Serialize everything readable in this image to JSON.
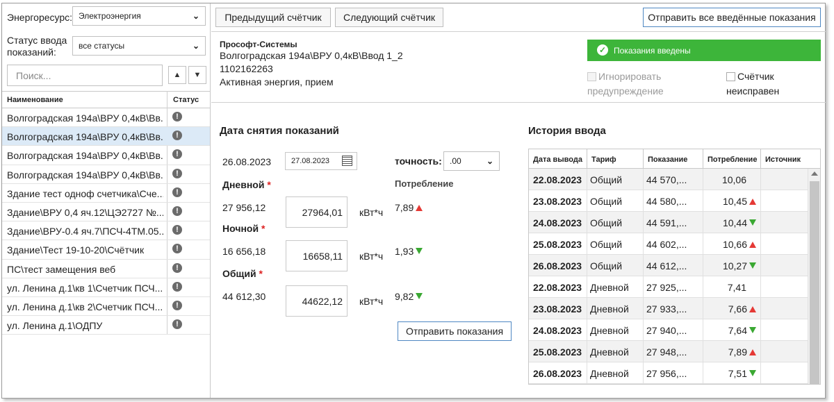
{
  "sidebar": {
    "resource_label": "Энергоресурс:",
    "resource_value": "Электроэнергия",
    "status_label_1": "Статус ввода",
    "status_label_2": "показаний:",
    "status_value": "все статусы",
    "search_placeholder": "Поиск...",
    "col_name": "Наименование",
    "col_status": "Статус",
    "items": [
      {
        "label": "Волгоградская 194а\\ВРУ 0,4кВ\\Вв...",
        "selected": false
      },
      {
        "label": "Волгоградская 194а\\ВРУ 0,4кВ\\Вв...",
        "selected": true
      },
      {
        "label": "Волгоградская 194а\\ВРУ 0,4кВ\\Вв...",
        "selected": false
      },
      {
        "label": "Волгоградская 194а\\ВРУ 0,4кВ\\Вв...",
        "selected": false
      },
      {
        "label": "Здание тест одноф счетчика\\Сче...",
        "selected": false
      },
      {
        "label": "Здание\\ВРУ 0,4 яч.12\\ЦЭ2727 №...",
        "selected": false
      },
      {
        "label": "Здание\\ВРУ-0.4 яч.7\\ПСЧ-4ТМ.05...",
        "selected": false
      },
      {
        "label": "Здание\\Тест 19-10-20\\Счётчик",
        "selected": false
      },
      {
        "label": "ПС\\тест замещения веб",
        "selected": false
      },
      {
        "label": "ул. Ленина д.1\\кв 1\\Счетчик ПСЧ...",
        "selected": false
      },
      {
        "label": "ул. Ленина д.1\\кв 2\\Счетчик ПСЧ...",
        "selected": false
      },
      {
        "label": "ул. Ленина д.1\\ОДПУ",
        "selected": false
      }
    ]
  },
  "toolbar": {
    "prev": "Предыдущий счётчик",
    "next": "Следующий счётчик",
    "send_all": "Отправить все введённые показания"
  },
  "meter": {
    "org": "Прософт-Системы",
    "path": "Волгоградская 194а\\ВРУ 0,4кВ\\Ввод 1_2",
    "serial": "1102162263",
    "type": "Активная энергия, прием",
    "badge": "Показания введены",
    "ignore_1": "Игнорировать",
    "ignore_2": "предупреждение",
    "faulty_1": "Счётчик",
    "faulty_2": "неисправен"
  },
  "readings": {
    "title": "Дата снятия показаний",
    "prev_date": "26.08.2023",
    "date_value": "27.08.2023",
    "accuracy_label": "точность:",
    "accuracy_value": ".00",
    "consumption_header": "Потребление",
    "tariffs": [
      {
        "name": "Дневной",
        "prev": "27 956,12",
        "value": "27964,01",
        "unit": "кВт*ч",
        "consumption": "7,89",
        "trend": "up"
      },
      {
        "name": "Ночной",
        "prev": "16 656,18",
        "value": "16658,11",
        "unit": "кВт*ч",
        "consumption": "1,93",
        "trend": "down"
      },
      {
        "name": "Общий",
        "prev": "44 612,30",
        "value": "44622,12",
        "unit": "кВт*ч",
        "consumption": "9,82",
        "trend": "down"
      }
    ],
    "submit": "Отправить показания"
  },
  "history": {
    "title": "История ввода",
    "columns": [
      "Дата вывода",
      "Тариф",
      "Показание",
      "Потребление",
      "Источник"
    ],
    "rows": [
      {
        "date": "22.08.2023",
        "tariff": "Общий",
        "reading": "44 570,...",
        "consumption": "10,06",
        "trend": "none"
      },
      {
        "date": "23.08.2023",
        "tariff": "Общий",
        "reading": "44 580,...",
        "consumption": "10,45",
        "trend": "up"
      },
      {
        "date": "24.08.2023",
        "tariff": "Общий",
        "reading": "44 591,...",
        "consumption": "10,44",
        "trend": "down"
      },
      {
        "date": "25.08.2023",
        "tariff": "Общий",
        "reading": "44 602,...",
        "consumption": "10,66",
        "trend": "up"
      },
      {
        "date": "26.08.2023",
        "tariff": "Общий",
        "reading": "44 612,...",
        "consumption": "10,27",
        "trend": "down"
      },
      {
        "date": "22.08.2023",
        "tariff": "Дневной",
        "reading": "27 925,...",
        "consumption": "7,41",
        "trend": "none"
      },
      {
        "date": "23.08.2023",
        "tariff": "Дневной",
        "reading": "27 933,...",
        "consumption": "7,66",
        "trend": "up"
      },
      {
        "date": "24.08.2023",
        "tariff": "Дневной",
        "reading": "27 940,...",
        "consumption": "7,64",
        "trend": "down"
      },
      {
        "date": "25.08.2023",
        "tariff": "Дневной",
        "reading": "27 948,...",
        "consumption": "7,89",
        "trend": "up"
      },
      {
        "date": "26.08.2023",
        "tariff": "Дневной",
        "reading": "27 956,...",
        "consumption": "7,51",
        "trend": "down"
      }
    ]
  }
}
